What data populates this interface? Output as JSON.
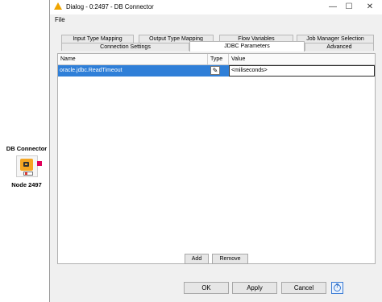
{
  "canvas": {
    "node": {
      "title": "DB Connector",
      "label": "Node 2497"
    }
  },
  "window": {
    "title": "Dialog - 0:2497 - DB Connector",
    "minimize": "—",
    "maximize": "☐",
    "close": "✕"
  },
  "menu": {
    "file": "File"
  },
  "tabs": {
    "row1": [
      "Input Type Mapping",
      "Output Type Mapping",
      "Flow Variables",
      "Job Manager Selection"
    ],
    "row2": [
      "Connection Settings",
      "JDBC Parameters",
      "Advanced"
    ],
    "active": "JDBC Parameters"
  },
  "table": {
    "columns": [
      "Name",
      "Type",
      "Value"
    ],
    "rows": [
      {
        "name": "oracle.jdbc.ReadTimeout",
        "type_icon": "edit-pencil-icon",
        "value": "<miliseconds>"
      }
    ]
  },
  "table_buttons": {
    "add": "Add",
    "remove": "Remove"
  },
  "footer": {
    "ok": "OK",
    "apply": "Apply",
    "cancel": "Cancel",
    "help": "?"
  },
  "colors": {
    "selection": "#2f7fd8",
    "warning_icon": "#f0a500",
    "node_body": "#f5a623",
    "node_port": "#e0005a"
  }
}
